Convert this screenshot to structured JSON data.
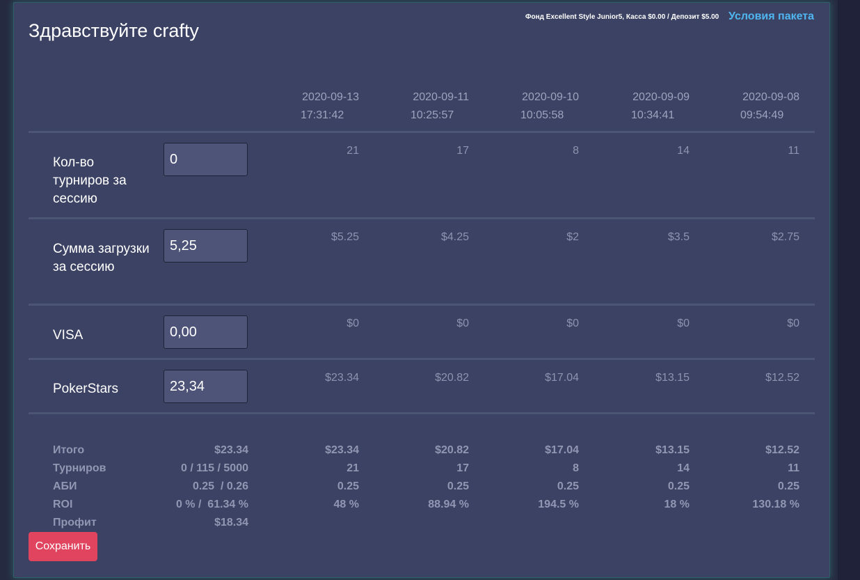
{
  "header": {
    "greeting": "Здравствуйте crafty",
    "fund_info": "Фонд Excellent Style Junior5, Касса $0.00 / Депозит $5.00",
    "terms_link": "Условия пакета"
  },
  "sessions": [
    {
      "date": "2020-09-13",
      "time": "17:31:42"
    },
    {
      "date": "2020-09-11",
      "time": "10:25:57"
    },
    {
      "date": "2020-09-10",
      "time": "10:05:58"
    },
    {
      "date": "2020-09-09",
      "time": "10:34:41"
    },
    {
      "date": "2020-09-08",
      "time": "09:54:49"
    }
  ],
  "rows": [
    {
      "label": "Кол-во турниров за сессию",
      "input": "0",
      "values": [
        "21",
        "17",
        "8",
        "14",
        "11"
      ]
    },
    {
      "label": "Сумма загрузки за сессию",
      "input": "5,25",
      "values": [
        "$5.25",
        "$4.25",
        "$2",
        "$3.5",
        "$2.75"
      ]
    },
    {
      "label": "VISA",
      "input": "0,00",
      "values": [
        "$0",
        "$0",
        "$0",
        "$0",
        "$0"
      ]
    },
    {
      "label": "PokerStars",
      "input": "23,34",
      "values": [
        "$23.34",
        "$20.82",
        "$17.04",
        "$13.15",
        "$12.52"
      ]
    }
  ],
  "summary": [
    {
      "label": "Итого",
      "total": "$23.34",
      "values": [
        "$23.34",
        "$20.82",
        "$17.04",
        "$13.15",
        "$12.52"
      ]
    },
    {
      "label": "Турниров",
      "total": "0 / 115 / 5000",
      "values": [
        "21",
        "17",
        "8",
        "14",
        "11"
      ]
    },
    {
      "label": "АБИ",
      "total": "0.25  / 0.26",
      "values": [
        "0.25",
        "0.25",
        "0.25",
        "0.25",
        "0.25"
      ]
    },
    {
      "label": "ROI",
      "total": "0 % /  61.34 %",
      "values": [
        "48 %",
        "88.94 %",
        "194.5 %",
        "18 %",
        "130.18 %"
      ]
    },
    {
      "label": "Профит",
      "total": "$18.34",
      "values": [
        "",
        "",
        "",
        "",
        ""
      ]
    }
  ],
  "actions": {
    "save_label": "Сохранить"
  }
}
